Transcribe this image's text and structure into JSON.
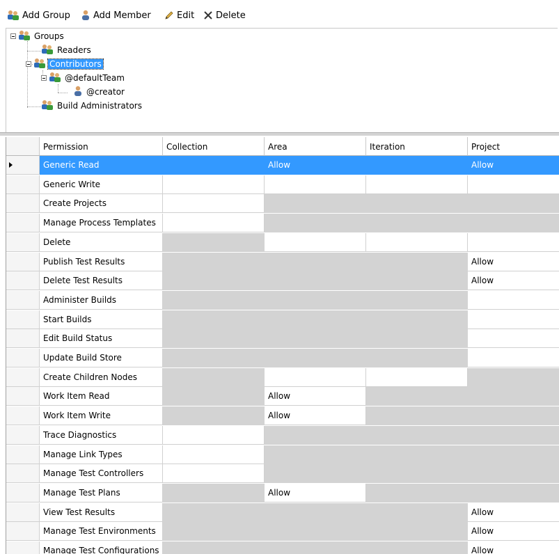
{
  "toolbar": {
    "add_group": "Add Group",
    "add_member": "Add Member",
    "edit": "Edit",
    "delete": "Delete"
  },
  "tree": {
    "root": "Groups",
    "readers": "Readers",
    "contributors": "Contributors",
    "default_team": "@defaultTeam",
    "creator": "@creator",
    "build_admins": "Build Administrators"
  },
  "grid": {
    "headers": [
      "Permission",
      "Collection",
      "Area",
      "Iteration",
      "Project"
    ],
    "selected_row": 0,
    "rows": [
      {
        "name": "Generic Read",
        "cells": [
          "",
          "Allow",
          "",
          "Allow"
        ],
        "grey": [
          0,
          0,
          0,
          0
        ]
      },
      {
        "name": "Generic Write",
        "cells": [
          "",
          "",
          "",
          ""
        ],
        "grey": [
          0,
          0,
          0,
          0
        ]
      },
      {
        "name": "Create Projects",
        "cells": [
          "",
          "",
          "",
          ""
        ],
        "grey": [
          0,
          1,
          1,
          1
        ]
      },
      {
        "name": "Manage Process Templates",
        "cells": [
          "",
          "",
          "",
          ""
        ],
        "grey": [
          0,
          1,
          1,
          1
        ]
      },
      {
        "name": "Delete",
        "cells": [
          "",
          "",
          "",
          ""
        ],
        "grey": [
          1,
          0,
          0,
          0
        ]
      },
      {
        "name": "Publish Test Results",
        "cells": [
          "",
          "",
          "",
          "Allow"
        ],
        "grey": [
          1,
          1,
          1,
          0
        ]
      },
      {
        "name": "Delete Test Results",
        "cells": [
          "",
          "",
          "",
          "Allow"
        ],
        "grey": [
          1,
          1,
          1,
          0
        ]
      },
      {
        "name": "Administer Builds",
        "cells": [
          "",
          "",
          "",
          ""
        ],
        "grey": [
          1,
          1,
          1,
          0
        ]
      },
      {
        "name": "Start Builds",
        "cells": [
          "",
          "",
          "",
          ""
        ],
        "grey": [
          1,
          1,
          1,
          0
        ]
      },
      {
        "name": "Edit Build Status",
        "cells": [
          "",
          "",
          "",
          ""
        ],
        "grey": [
          1,
          1,
          1,
          0
        ]
      },
      {
        "name": "Update Build Store",
        "cells": [
          "",
          "",
          "",
          ""
        ],
        "grey": [
          1,
          1,
          1,
          0
        ]
      },
      {
        "name": "Create Children Nodes",
        "cells": [
          "",
          "",
          "",
          ""
        ],
        "grey": [
          1,
          0,
          0,
          1
        ]
      },
      {
        "name": "Work Item Read",
        "cells": [
          "",
          "Allow",
          "",
          ""
        ],
        "grey": [
          1,
          0,
          1,
          1
        ]
      },
      {
        "name": "Work Item Write",
        "cells": [
          "",
          "Allow",
          "",
          ""
        ],
        "grey": [
          1,
          0,
          1,
          1
        ]
      },
      {
        "name": "Trace Diagnostics",
        "cells": [
          "",
          "",
          "",
          ""
        ],
        "grey": [
          0,
          1,
          1,
          1
        ]
      },
      {
        "name": "Manage Link Types",
        "cells": [
          "",
          "",
          "",
          ""
        ],
        "grey": [
          0,
          1,
          1,
          1
        ]
      },
      {
        "name": "Manage Test Controllers",
        "cells": [
          "",
          "",
          "",
          ""
        ],
        "grey": [
          0,
          1,
          1,
          1
        ]
      },
      {
        "name": "Manage Test Plans",
        "cells": [
          "",
          "Allow",
          "",
          ""
        ],
        "grey": [
          1,
          0,
          1,
          1
        ]
      },
      {
        "name": "View Test Results",
        "cells": [
          "",
          "",
          "",
          "Allow"
        ],
        "grey": [
          1,
          1,
          1,
          0
        ]
      },
      {
        "name": "Manage Test Environments",
        "cells": [
          "",
          "",
          "",
          "Allow"
        ],
        "grey": [
          1,
          1,
          1,
          0
        ]
      },
      {
        "name": "Manage Test Configurations",
        "cells": [
          "",
          "",
          "",
          "Allow"
        ],
        "grey": [
          1,
          1,
          1,
          0
        ]
      }
    ]
  },
  "icons": {
    "group": "group-icon",
    "user": "user-icon",
    "edit": "pencil-icon",
    "delete": "x-icon"
  },
  "colors": {
    "selection": "#3399ff",
    "disabled_cell": "#d3d3d3"
  }
}
